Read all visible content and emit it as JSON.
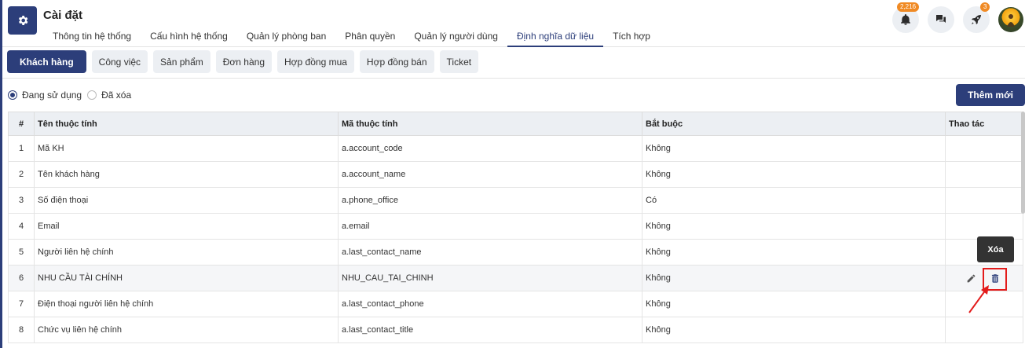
{
  "header": {
    "title": "Cài đặt",
    "tabs": [
      {
        "label": "Thông tin hệ thống",
        "active": false
      },
      {
        "label": "Cấu hình hệ thống",
        "active": false
      },
      {
        "label": "Quản lý phòng ban",
        "active": false
      },
      {
        "label": "Phân quyền",
        "active": false
      },
      {
        "label": "Quản lý người dùng",
        "active": false
      },
      {
        "label": "Định nghĩa dữ liệu",
        "active": true
      },
      {
        "label": "Tích hợp",
        "active": false
      }
    ],
    "notification_count": "2,216",
    "rocket_count": "3"
  },
  "entity_tabs": [
    {
      "label": "Khách hàng",
      "active": true
    },
    {
      "label": "Công việc",
      "active": false
    },
    {
      "label": "Sản phẩm",
      "active": false
    },
    {
      "label": "Đơn hàng",
      "active": false
    },
    {
      "label": "Hợp đồng mua",
      "active": false
    },
    {
      "label": "Hợp đồng bán",
      "active": false
    },
    {
      "label": "Ticket",
      "active": false
    }
  ],
  "filters": {
    "in_use": "Đang sử dụng",
    "deleted": "Đã xóa",
    "selected": "in_use"
  },
  "add_button": "Thêm mới",
  "table": {
    "headers": [
      "#",
      "Tên thuộc tính",
      "Mã thuộc tính",
      "Bắt buộc",
      "Thao tác"
    ],
    "rows": [
      {
        "idx": "1",
        "name": "Mã KH",
        "code": "a.account_code",
        "required": "Không"
      },
      {
        "idx": "2",
        "name": "Tên khách hàng",
        "code": "a.account_name",
        "required": "Không"
      },
      {
        "idx": "3",
        "name": "Số điện thoại",
        "code": "a.phone_office",
        "required": "Có"
      },
      {
        "idx": "4",
        "name": "Email",
        "code": "a.email",
        "required": "Không"
      },
      {
        "idx": "5",
        "name": "Người liên hệ chính",
        "code": "a.last_contact_name",
        "required": "Không"
      },
      {
        "idx": "6",
        "name": "NHU CẦU TÀI CHÍNH",
        "code": "NHU_CAU_TAI_CHINH",
        "required": "Không"
      },
      {
        "idx": "7",
        "name": "Điện thoại người liên hệ chính",
        "code": "a.last_contact_phone",
        "required": "Không"
      },
      {
        "idx": "8",
        "name": "Chức vụ liên hệ chính",
        "code": "a.last_contact_title",
        "required": "Không"
      }
    ]
  },
  "tooltip": "Xóa",
  "colors": {
    "primary": "#2c3e7a",
    "badge": "#f08a24",
    "highlight": "#e31b1b"
  }
}
